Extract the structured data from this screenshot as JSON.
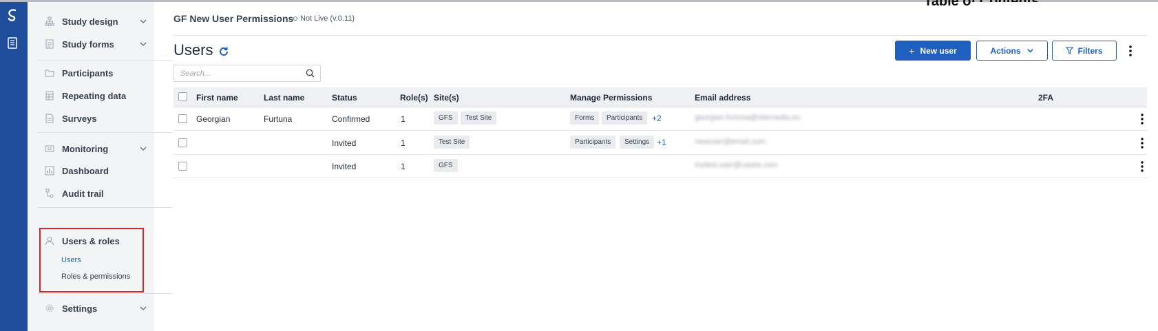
{
  "study": {
    "title": "GF New User Permissions",
    "status": "Not Live (v.0.11)"
  },
  "overlay_text": "Table of Contents",
  "sidebar": {
    "items": [
      {
        "label": "Study design",
        "icon": "sitemap-icon",
        "chevron": true
      },
      {
        "label": "Study forms",
        "icon": "form-doc-icon",
        "chevron": true
      },
      {
        "label": "Participants",
        "icon": "folder-icon",
        "chevron": false
      },
      {
        "label": "Repeating data",
        "icon": "table-doc-icon",
        "chevron": false
      },
      {
        "label": "Surveys",
        "icon": "survey-doc-icon",
        "chevron": false
      },
      {
        "label": "Monitoring",
        "icon": "monitor-icon",
        "chevron": true
      },
      {
        "label": "Dashboard",
        "icon": "bar-chart-icon",
        "chevron": false
      },
      {
        "label": "Audit trail",
        "icon": "audit-icon",
        "chevron": false
      },
      {
        "label": "Users & roles",
        "icon": "user-icon",
        "chevron": false
      },
      {
        "label": "Settings",
        "icon": "gear-icon",
        "chevron": true
      }
    ],
    "users_sub": [
      {
        "label": "Users",
        "active": true
      },
      {
        "label": "Roles & permissions",
        "active": false
      }
    ]
  },
  "page": {
    "title": "Users",
    "new_user": "New user",
    "actions": "Actions",
    "filters": "Filters",
    "search_placeholder": "Search..."
  },
  "table": {
    "columns": [
      "First name",
      "Last name",
      "Status",
      "Role(s)",
      "Site(s)",
      "Manage Permissions",
      "Email address",
      "2FA"
    ],
    "rows": [
      {
        "first": "Georgian",
        "last": "Furtuna",
        "status": "Confirmed",
        "roles": "1",
        "sites": [
          "GFS",
          "Test Site"
        ],
        "permissions": [
          "Forms",
          "Participants"
        ],
        "more": "+2",
        "email": "georgian.furtuna@sitemedia.eu"
      },
      {
        "first": "",
        "last": "",
        "status": "Invited",
        "roles": "1",
        "sites": [
          "Test Site"
        ],
        "permissions": [
          "Participants",
          "Settings"
        ],
        "more": "+1",
        "email": "newuser@email.com"
      },
      {
        "first": "",
        "last": "",
        "status": "Invited",
        "roles": "1",
        "sites": [
          "GFS"
        ],
        "permissions": [],
        "more": "",
        "email": "invited.user@castor.com"
      }
    ]
  },
  "colors": {
    "brand": "#1f4e9c",
    "accent": "#1f5fbf",
    "highlight": "#e0222a"
  }
}
